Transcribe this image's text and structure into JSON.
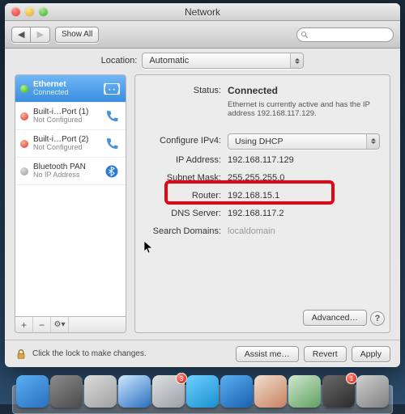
{
  "window": {
    "title": "Network"
  },
  "toolbar": {
    "show_all_label": "Show All"
  },
  "search": {
    "placeholder": ""
  },
  "location": {
    "label": "Location:",
    "value": "Automatic"
  },
  "sidebar": {
    "items": [
      {
        "name": "Ethernet",
        "sub": "Connected",
        "status": "green",
        "icon": "ethernet-icon"
      },
      {
        "name": "Built-i…Port (1)",
        "sub": "Not Configured",
        "status": "red",
        "icon": "phone-icon"
      },
      {
        "name": "Built-i…Port (2)",
        "sub": "Not Configured",
        "status": "red",
        "icon": "phone-icon"
      },
      {
        "name": "Bluetooth PAN",
        "sub": "No IP Address",
        "status": "gray",
        "icon": "bluetooth-icon"
      }
    ]
  },
  "details": {
    "status_label": "Status:",
    "status_value": "Connected",
    "status_desc": "Ethernet is currently active and has the IP address 192.168.117.129.",
    "configure_label": "Configure IPv4:",
    "configure_value": "Using DHCP",
    "ip_label": "IP Address:",
    "ip_value": "192.168.117.129",
    "subnet_label": "Subnet Mask:",
    "subnet_value": "255.255.255.0",
    "router_label": "Router:",
    "router_value": "192.168.15.1",
    "dns_label": "DNS Server:",
    "dns_value": "192.168.117.2",
    "search_label": "Search Domains:",
    "search_value": "localdomain",
    "advanced_label": "Advanced…"
  },
  "footer": {
    "lock_text": "Click the lock to make changes.",
    "assist_label": "Assist me…",
    "revert_label": "Revert",
    "apply_label": "Apply"
  },
  "highlight": {
    "target": "router"
  },
  "dock": {
    "items": [
      {
        "name": "finder",
        "color1": "#5ab0f0",
        "color2": "#2a6fc0"
      },
      {
        "name": "launchpad",
        "color1": "#8c8c8c",
        "color2": "#4a4a4a"
      },
      {
        "name": "app1",
        "color1": "#dcdcdc",
        "color2": "#a0a0a0"
      },
      {
        "name": "safari",
        "color1": "#d0e8ff",
        "color2": "#2a6fc0"
      },
      {
        "name": "mail",
        "color1": "#e0e0e0",
        "color2": "#9aa0a8",
        "badge": "3"
      },
      {
        "name": "ichat",
        "color1": "#6fd0ff",
        "color2": "#1a90d0"
      },
      {
        "name": "itunes",
        "color1": "#5ab0f0",
        "color2": "#1a60b0"
      },
      {
        "name": "ical",
        "color1": "#f0e0d0",
        "color2": "#c88060"
      },
      {
        "name": "preview",
        "color1": "#d0e8d0",
        "color2": "#60a060"
      },
      {
        "name": "appstore",
        "color1": "#6a6a6a",
        "color2": "#2a2a2a",
        "badge": "1"
      },
      {
        "name": "sysprefs",
        "color1": "#d0d0d0",
        "color2": "#808080"
      }
    ]
  }
}
